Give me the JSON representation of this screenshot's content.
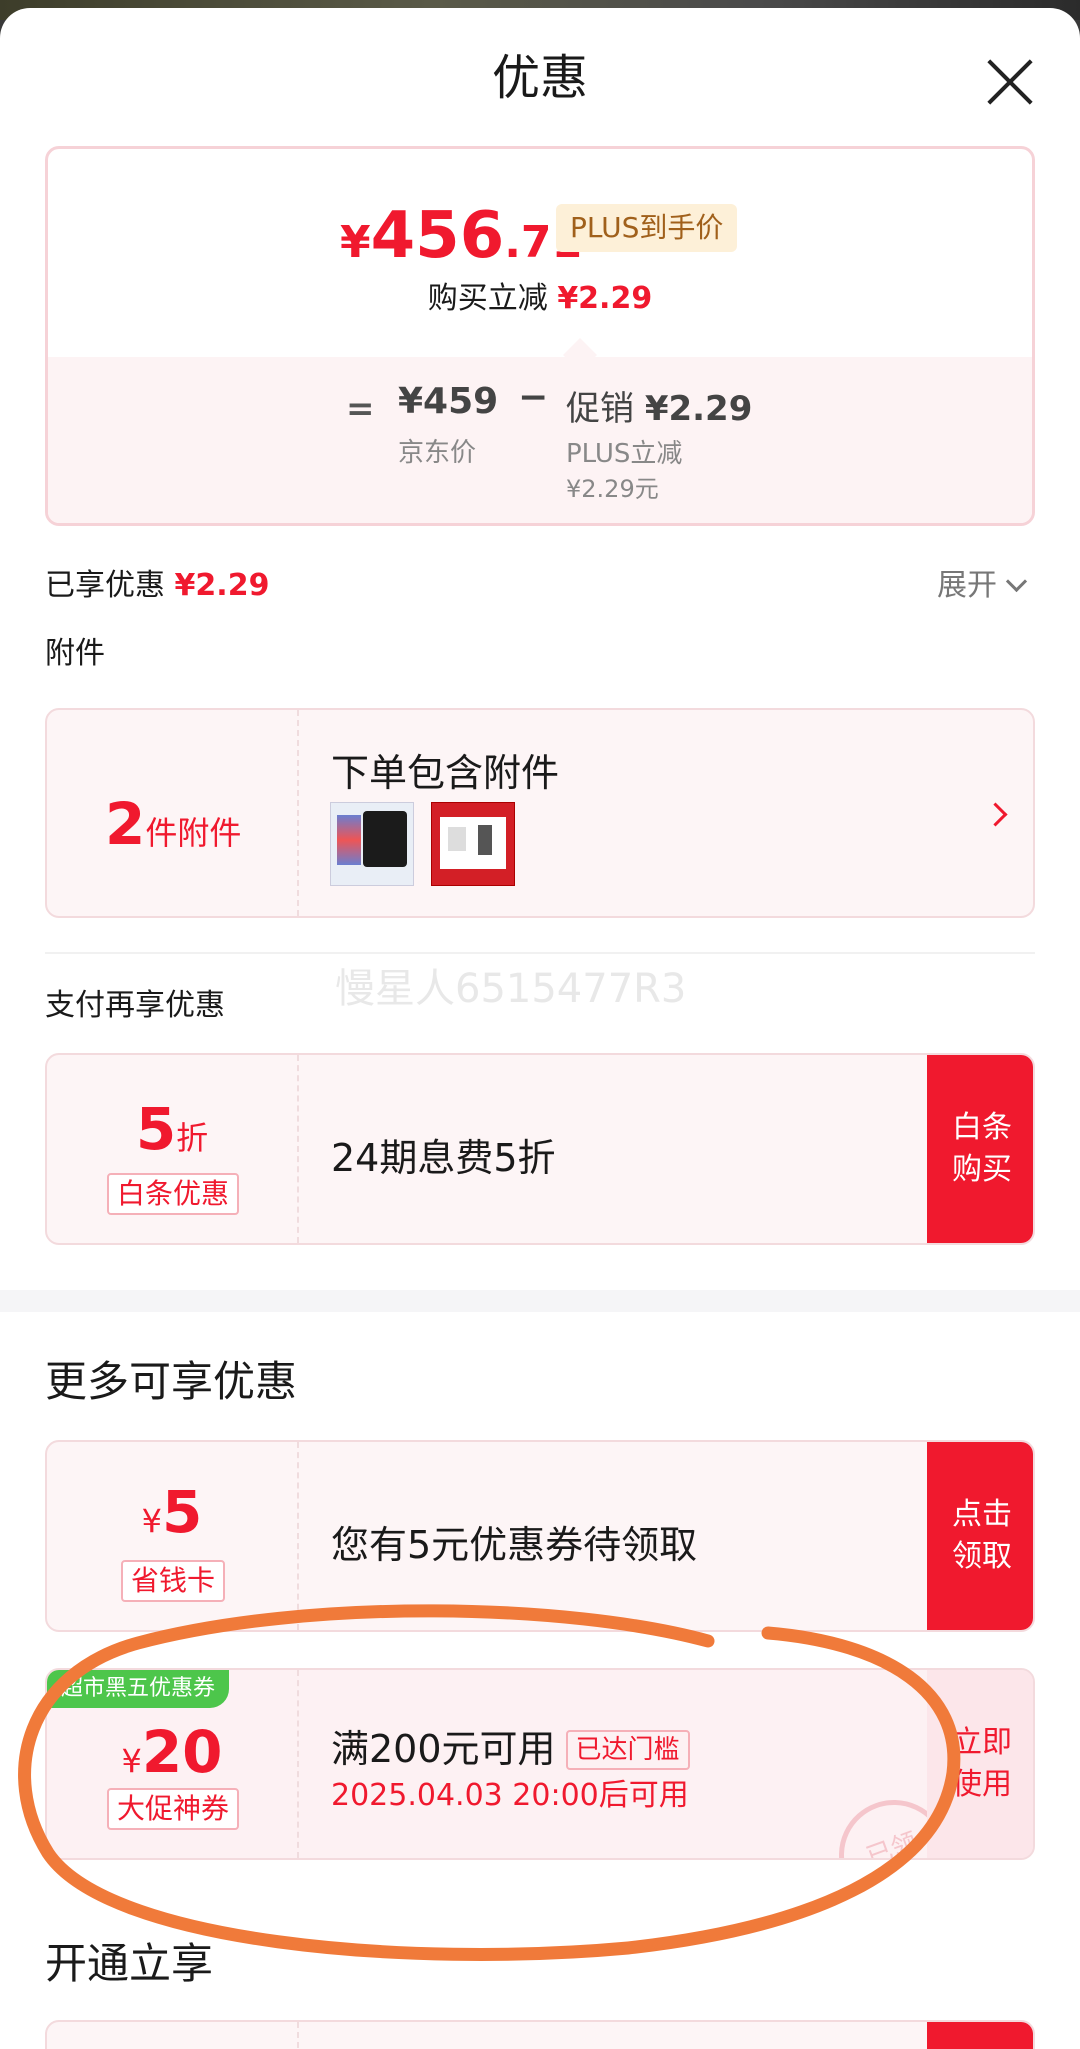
{
  "title": "优惠",
  "price": {
    "yen": "¥",
    "integer": "456",
    "decimal": ".71",
    "plus_tag": "PLUS到手价",
    "reduce_label": "购买立减",
    "reduce_amount": "¥2.29"
  },
  "breakdown": {
    "eq": "=",
    "jd_price": "¥459",
    "jd_label": "京东价",
    "minus": "−",
    "promo_label": "促销",
    "promo_amount": "¥2.29",
    "plus_reduce_label": "PLUS立减",
    "plus_reduce_amount": "¥2.29元"
  },
  "enjoyed": {
    "label": "已享优惠",
    "amount": "¥2.29",
    "expand": "展开"
  },
  "attachments": {
    "section_label": "附件",
    "count": "2",
    "count_unit": "件附件",
    "heading": "下单包含附件"
  },
  "watermark": "慢星人6515477R3",
  "pay": {
    "section_label": "支付再享优惠",
    "value": "5",
    "suffix": "折",
    "tag": "白条优惠",
    "desc": "24期息费5折",
    "button": "白条\n购买"
  },
  "more": {
    "section_label": "更多可享优惠",
    "save_card": {
      "yen": "¥",
      "value": "5",
      "tag": "省钱卡",
      "desc": "您有5元优惠券待领取",
      "button": "点击\n领取"
    },
    "coupon": {
      "ribbon": "超市黑五优惠券",
      "yen": "¥",
      "value": "20",
      "tag": "大促神券",
      "desc": "满200元可用",
      "reached": "已达门槛",
      "date": "2025.04.03 20:00后可用",
      "button": "立即\n使用",
      "stamp": "已领"
    }
  },
  "open_section_label": "开通立享",
  "colors": {
    "accent": "#f0192e",
    "ribbon": "#4dc64b",
    "annotation": "#f07a3a"
  }
}
